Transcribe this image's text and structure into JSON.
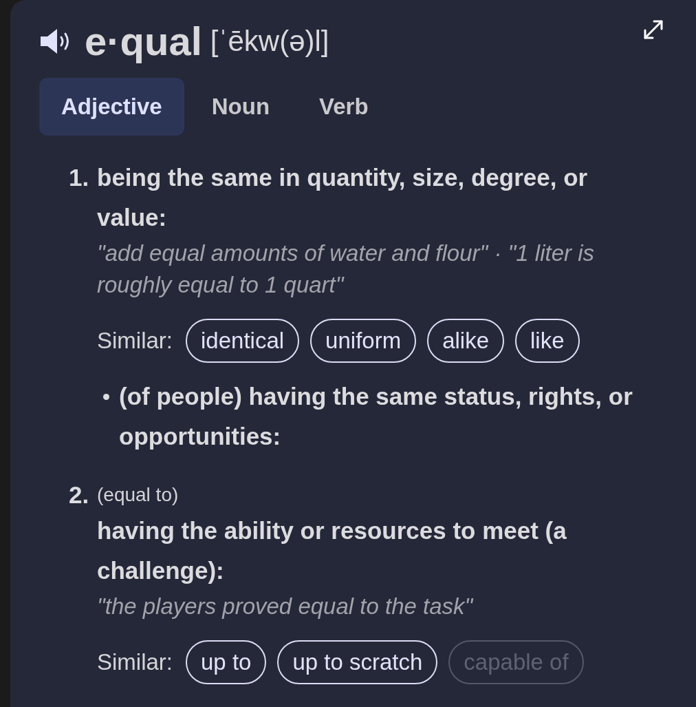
{
  "header": {
    "word": "e·qual",
    "pronunciation": "[ˈēkw(ə)l]"
  },
  "tabs": [
    {
      "label": "Adjective",
      "selected": true
    },
    {
      "label": "Noun",
      "selected": false
    },
    {
      "label": "Verb",
      "selected": false
    }
  ],
  "senses": [
    {
      "number": "1.",
      "definition": "being the same in quantity, size, degree, or value:",
      "example": "\"add equal amounts of water and flour\" · \"1 liter is roughly equal to 1 quart\"",
      "similar_label": "Similar:",
      "similar": [
        {
          "label": "identical",
          "faded": false
        },
        {
          "label": "uniform",
          "faded": false
        },
        {
          "label": "alike",
          "faded": false
        },
        {
          "label": "like",
          "faded": false
        }
      ],
      "subsenses": [
        {
          "definition": "(of people) having the same status, rights, or opportunities:"
        }
      ]
    },
    {
      "number": "2.",
      "label": "(equal to)",
      "definition": "having the ability or resources to meet (a challenge):",
      "example": "\"the players proved equal to the task\"",
      "similar_label": "Similar:",
      "similar": [
        {
          "label": "up to",
          "faded": false
        },
        {
          "label": "up to scratch",
          "faded": false
        },
        {
          "label": "capable of",
          "faded": true
        }
      ]
    }
  ]
}
